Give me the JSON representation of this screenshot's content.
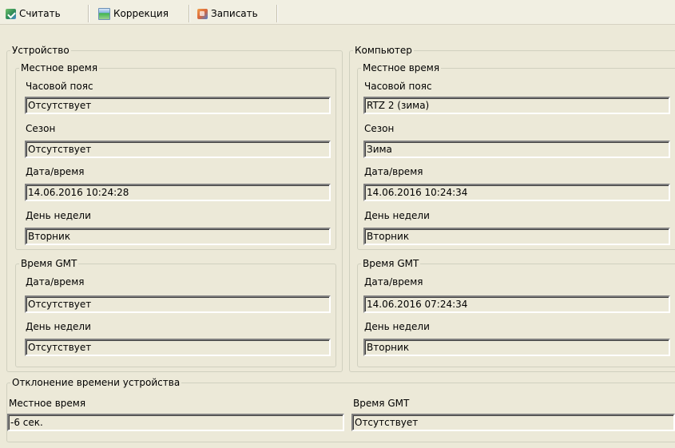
{
  "toolbar": {
    "read_label": "Считать",
    "correction_label": "Коррекция",
    "write_label": "Записать"
  },
  "device": {
    "title": "Устройство",
    "local": {
      "title": "Местное время",
      "timezone_label": "Часовой пояс",
      "timezone_value": "Отсутствует",
      "season_label": "Сезон",
      "season_value": "Отсутствует",
      "datetime_label": "Дата/время",
      "datetime_value": "14.06.2016 10:24:28",
      "weekday_label": "День недели",
      "weekday_value": "Вторник"
    },
    "gmt": {
      "title": "Время GMT",
      "datetime_label": "Дата/время",
      "datetime_value": "Отсутствует",
      "weekday_label": "День недели",
      "weekday_value": "Отсутствует"
    }
  },
  "computer": {
    "title": "Компьютер",
    "local": {
      "title": "Местное время",
      "timezone_label": "Часовой пояс",
      "timezone_value": "RTZ 2 (зима)",
      "season_label": "Сезон",
      "season_value": "Зима",
      "datetime_label": "Дата/время",
      "datetime_value": "14.06.2016 10:24:34",
      "weekday_label": "День недели",
      "weekday_value": "Вторник"
    },
    "gmt": {
      "title": "Время GMT",
      "datetime_label": "Дата/время",
      "datetime_value": "14.06.2016 07:24:34",
      "weekday_label": "День недели",
      "weekday_value": "Вторник"
    }
  },
  "deviation": {
    "title": "Отклонение времени устройства",
    "local_label": "Местное время",
    "local_value": "-6 сек.",
    "gmt_label": "Время GMT",
    "gmt_value": "Отсутствует"
  },
  "icons": {
    "read": "read-icon",
    "correction": "correction-icon",
    "write": "write-icon"
  }
}
